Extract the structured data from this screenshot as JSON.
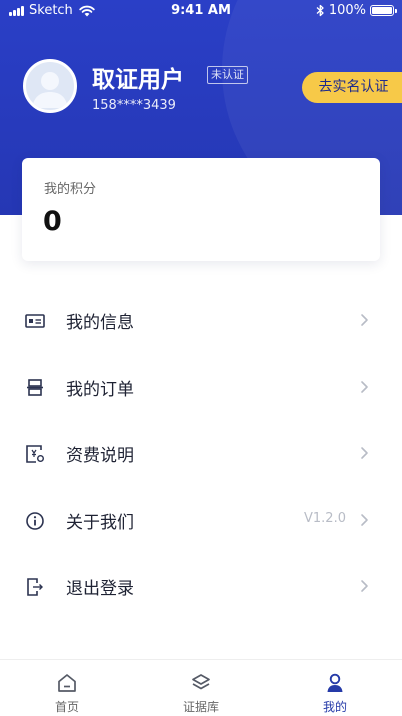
{
  "status_bar": {
    "carrier": "Sketch",
    "time": "9:41 AM",
    "battery": "100%"
  },
  "profile": {
    "name": "取证用户",
    "verify_status": "未认证",
    "phone": "158****3439",
    "real_name_button": "去实名认证"
  },
  "points": {
    "label": "我的积分",
    "value": "0"
  },
  "menu": {
    "items": [
      {
        "label": "我的信息",
        "icon": "id-card-icon"
      },
      {
        "label": "我的订单",
        "icon": "order-icon"
      },
      {
        "label": "资费说明",
        "icon": "fee-icon"
      },
      {
        "label": "关于我们",
        "icon": "info-icon",
        "value": "V1.2.0"
      },
      {
        "label": "退出登录",
        "icon": "logout-icon"
      }
    ]
  },
  "tabbar": {
    "tabs": [
      {
        "label": "首页",
        "icon": "home-icon"
      },
      {
        "label": "证据库",
        "icon": "layers-icon"
      },
      {
        "label": "我的",
        "icon": "user-icon",
        "active": true
      }
    ]
  },
  "colors": {
    "primary": "#2a3fc7",
    "accent": "#f7c948",
    "active_tab": "#253aa8"
  }
}
